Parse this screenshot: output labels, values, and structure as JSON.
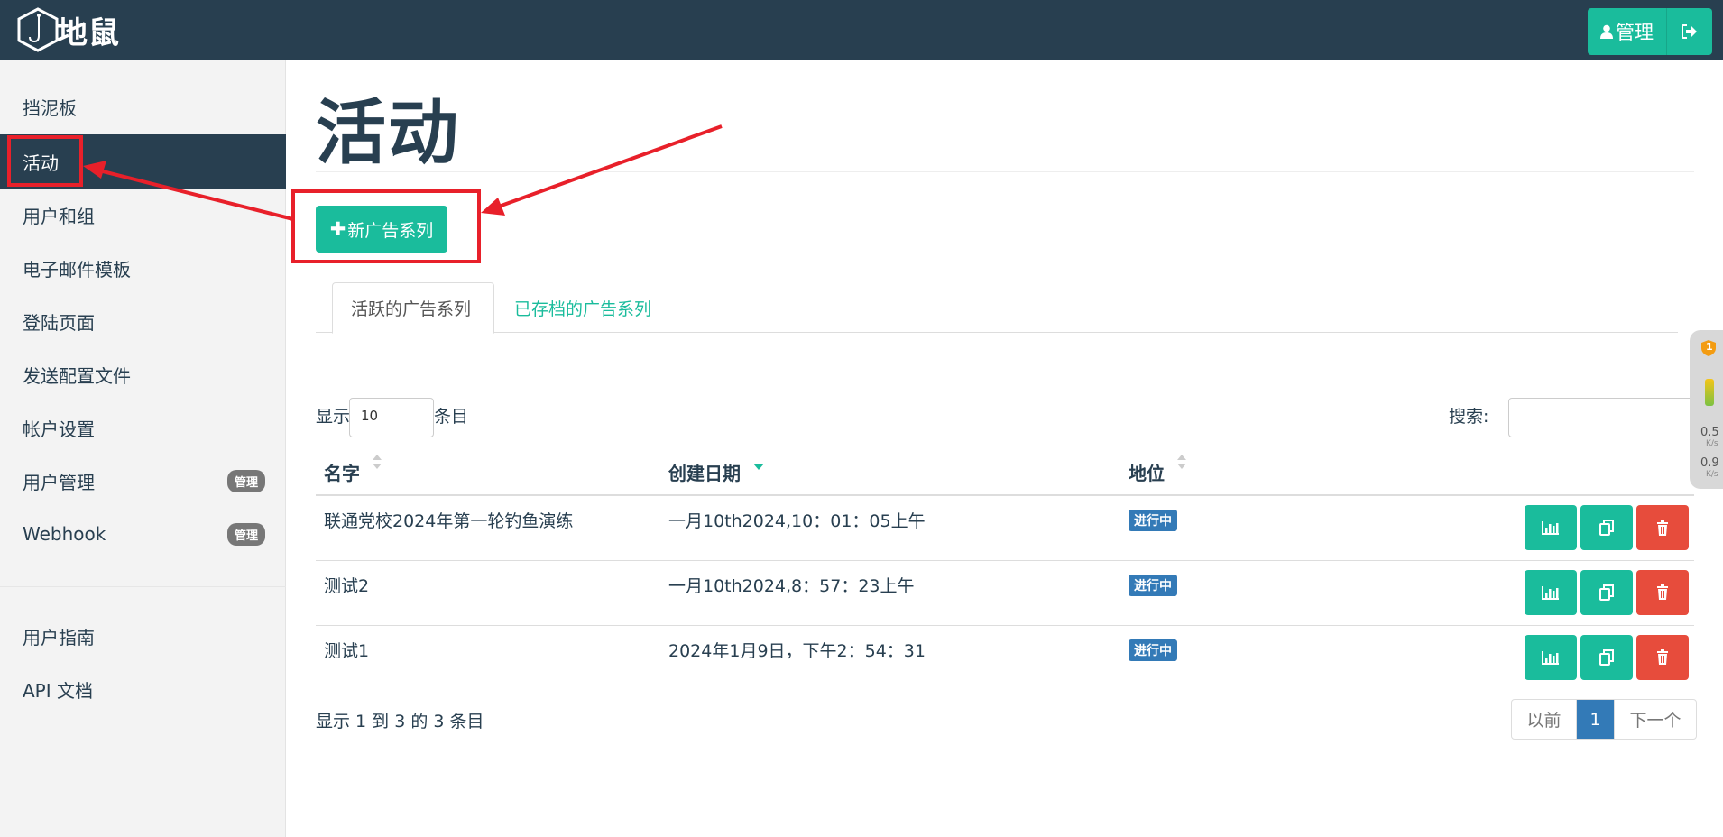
{
  "brand": {
    "name": "地鼠",
    "logo_icon": "hexagon-hook-logo"
  },
  "header": {
    "admin_label": "管理",
    "admin_icon": "user-icon",
    "logout_icon": "sign-out-icon"
  },
  "sidebar": {
    "items": [
      {
        "label": "挡泥板"
      },
      {
        "label": "活动",
        "active": true
      },
      {
        "label": "用户和组"
      },
      {
        "label": "电子邮件模板"
      },
      {
        "label": "登陆页面"
      },
      {
        "label": "发送配置文件"
      },
      {
        "label": "帐户设置"
      },
      {
        "label": "用户管理",
        "badge": "管理"
      },
      {
        "label": "Webhook",
        "badge": "管理"
      }
    ],
    "footer_items": [
      {
        "label": "用户指南"
      },
      {
        "label": "API 文档"
      }
    ]
  },
  "main": {
    "title": "活动",
    "new_button": {
      "plus": "✚",
      "label": "新广告系列"
    },
    "tabs": [
      {
        "label": "活跃的广告系列",
        "active": true
      },
      {
        "label": "已存档的广告系列",
        "active": false
      }
    ],
    "length": {
      "prefix": "显示",
      "value": "10",
      "suffix": "条目"
    },
    "search": {
      "label": "搜索:",
      "value": ""
    },
    "table": {
      "columns": [
        "名字",
        "创建日期",
        "地位"
      ],
      "sorted_column": "创建日期",
      "rows": [
        {
          "name": "联通党校2024年第一轮钓鱼演练",
          "date": "一月10th2024,10：01：05上午",
          "status": "进行中"
        },
        {
          "name": "测试2",
          "date": "一月10th2024,8：57：23上午",
          "status": "进行中"
        },
        {
          "name": "测试1",
          "date": "2024年1月9日，下午2：54：31",
          "status": "进行中"
        }
      ],
      "row_actions": [
        "bar-chart-icon",
        "copy-icon",
        "trash-icon"
      ]
    },
    "info": "显示 1 到 3 的 3 条目",
    "pagination": {
      "prev": "以前",
      "current": "1",
      "next": "下一个"
    }
  },
  "widget": {
    "badge": "1",
    "up": "0.5",
    "down": "0.9",
    "unit": "K/s"
  },
  "colors": {
    "navy": "#283f50",
    "teal": "#1abc9c",
    "red": "#e74c3c",
    "blue": "#337ab7",
    "annotation": "#e8202a"
  }
}
